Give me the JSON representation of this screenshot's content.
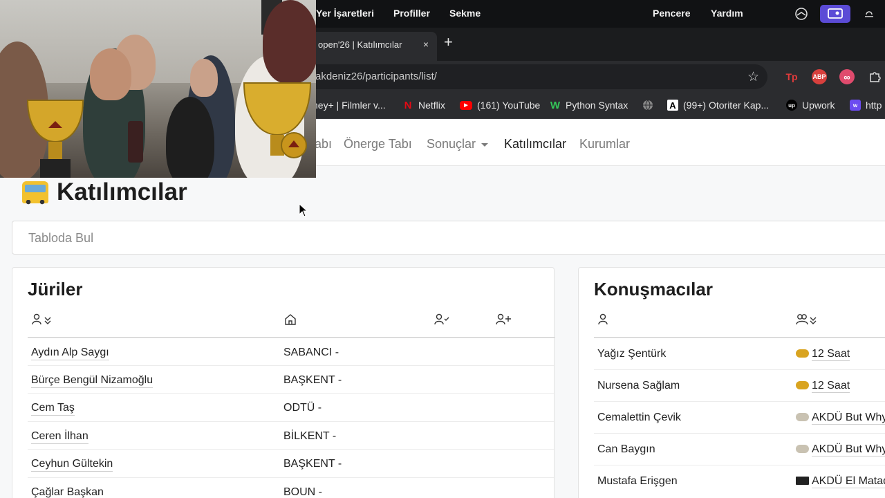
{
  "menubar": {
    "items": [
      "Yer İşaretleri",
      "Profiller",
      "Sekme",
      "Pencere",
      "Yardım"
    ]
  },
  "browser": {
    "tab_title": "open'26 | Katılımcılar",
    "tab_close": "×",
    "new_tab": "+",
    "url": "akdeniz26/participants/list/",
    "extensions": [
      "Tp",
      "ABP",
      "∞"
    ]
  },
  "bookmarks": [
    {
      "label": "ney+ | Filmler v...",
      "icon": "disney-icon"
    },
    {
      "label": "Netflix",
      "icon": "netflix-icon"
    },
    {
      "label": "(161) YouTube",
      "icon": "youtube-icon"
    },
    {
      "label": "Python Syntax",
      "icon": "w-icon"
    },
    {
      "label": "",
      "icon": "globe-icon"
    },
    {
      "label": "(99+) Otoriter Kap...",
      "icon": "a-icon"
    },
    {
      "label": "Upwork",
      "icon": "upwork-icon"
    },
    {
      "label": "http",
      "icon": "web-icon"
    }
  ],
  "sitenav": {
    "items": [
      {
        "label": "abı",
        "active": false
      },
      {
        "label": "Önerge Tabı",
        "active": false
      },
      {
        "label": "Sonuçlar",
        "active": false,
        "dropdown": true
      },
      {
        "label": "Katılımcılar",
        "active": true
      },
      {
        "label": "Kurumlar",
        "active": false
      }
    ]
  },
  "page": {
    "title": "Katılımcılar",
    "search_placeholder": "Tabloda Bul"
  },
  "judges": {
    "title": "Jüriler",
    "rows": [
      {
        "name": "Aydın Alp Saygı",
        "institution": "SABANCI -"
      },
      {
        "name": "Bürçe Bengül Nizamoğlu",
        "institution": "BAŞKENT -"
      },
      {
        "name": "Cem Taş",
        "institution": "ODTÜ -"
      },
      {
        "name": "Ceren İlhan",
        "institution": "BİLKENT -"
      },
      {
        "name": "Ceyhun Gültekin",
        "institution": "BAŞKENT -"
      },
      {
        "name": "Çağlar Başkan",
        "institution": "BOUN -"
      }
    ]
  },
  "speakers": {
    "title": "Konuşmacılar",
    "rows": [
      {
        "name": "Yağız Şentürk",
        "team": "12 Saat",
        "emoji_color": "#d9a420"
      },
      {
        "name": "Nursena Sağlam",
        "team": "12 Saat",
        "emoji_color": "#d9a420"
      },
      {
        "name": "Cemalettin Çevik",
        "team": "AKDÜ But Why",
        "emoji_color": "#c9c2b2"
      },
      {
        "name": "Can Baygın",
        "team": "AKDÜ But Why",
        "emoji_color": "#c9c2b2"
      },
      {
        "name": "Mustafa Erişgen",
        "team": "AKDÜ El Matad",
        "emoji_color": "#222222"
      }
    ]
  }
}
